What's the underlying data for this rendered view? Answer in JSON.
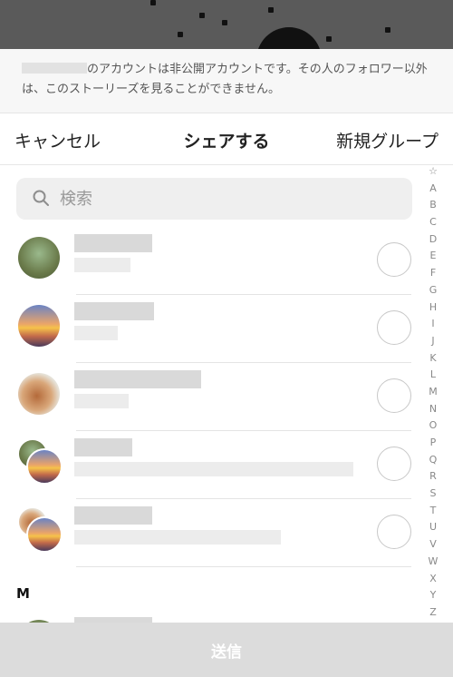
{
  "notice": {
    "text": "のアカウントは非公開アカウントです。その人のフォロワー以外は、このストーリーズを見ることができません。"
  },
  "action_bar": {
    "cancel_label": "キャンセル",
    "title": "シェアする",
    "new_group_label": "新規グループ"
  },
  "search": {
    "placeholder": "検索"
  },
  "section_header": "M",
  "index_letters": [
    "☆",
    "A",
    "B",
    "C",
    "D",
    "E",
    "F",
    "G",
    "H",
    "I",
    "J",
    "K",
    "L",
    "M",
    "N",
    "O",
    "P",
    "Q",
    "R",
    "S",
    "T",
    "U",
    "V",
    "W",
    "X",
    "Y",
    "Z"
  ],
  "send": {
    "label": "送信"
  },
  "colors": {
    "send_bar_bg": "#dcdcdc",
    "search_bg": "#efefef",
    "notice_bg": "#f7f7f7"
  }
}
